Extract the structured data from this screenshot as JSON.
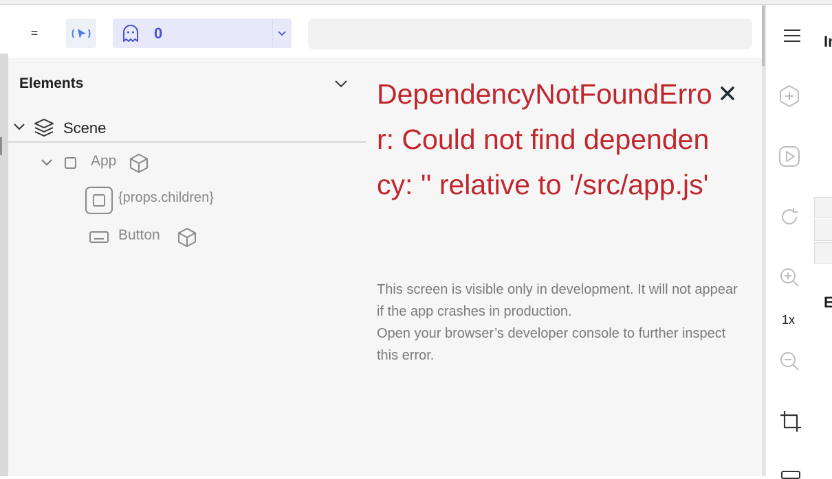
{
  "toolbar": {
    "menu_glyph": "=",
    "ghost_count": "0",
    "search_value": ""
  },
  "elements_panel": {
    "title": "Elements",
    "tree": {
      "scene": "Scene",
      "app": "App",
      "props_children": "{props.children}",
      "button": "Button"
    }
  },
  "error": {
    "title": "DependencyNotFoundError: Could not find dependency: '' relative to '/src/app.js'",
    "description_line1": "This screen is visible only in development. It will not appear if the app crashes in production.",
    "description_line2": "Open your browser’s developer console to further inspect this error."
  },
  "right_panel": {
    "zoom_label": "1x",
    "peek_top": "In",
    "peek_mid": "E"
  },
  "colors": {
    "error_red": "#c0272d",
    "accent_indigo": "#4a4fd0",
    "ghost_bg": "#e7e9fb",
    "panel_bg": "#f6f6f6"
  },
  "icons": [
    "menu-icon",
    "select-mode-icon",
    "ghost-icon",
    "chevron-down-icon",
    "layers-icon",
    "square-icon",
    "cube-icon",
    "component-icon",
    "button-icon",
    "close-icon",
    "hamburger-icon",
    "add-circle-icon",
    "play-icon",
    "refresh-icon",
    "zoom-in-icon",
    "zoom-out-icon",
    "crop-icon"
  ]
}
